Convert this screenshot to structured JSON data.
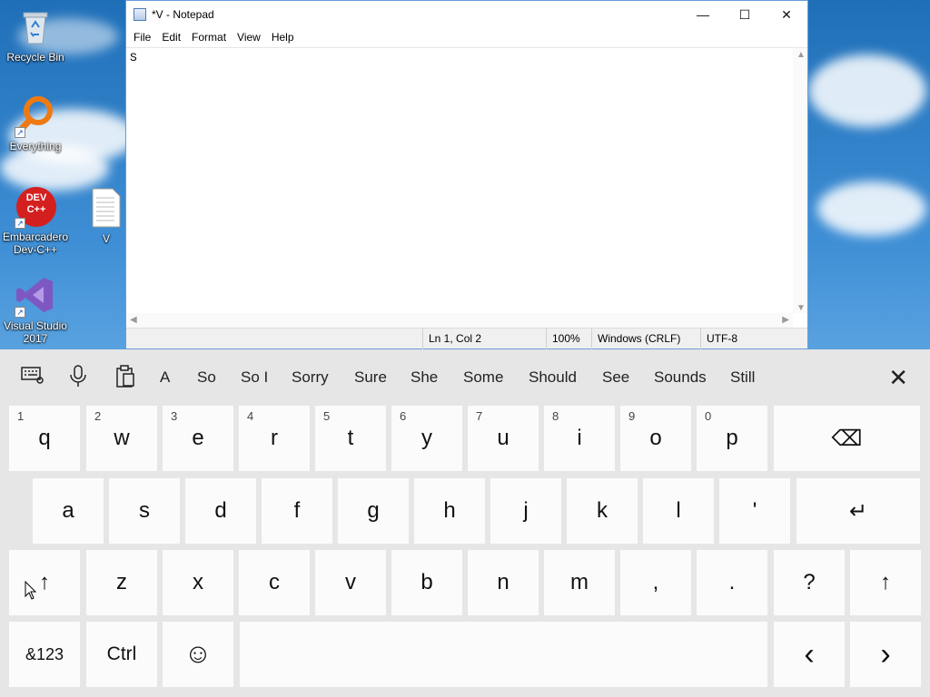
{
  "desktop": {
    "icons": [
      {
        "label": "Recycle Bin",
        "icon": "recycle-bin-icon"
      },
      {
        "label": "Everything",
        "icon": "everything-search-icon"
      },
      {
        "label": "Embarcadero Dev-C++",
        "icon": "devcpp-icon",
        "badge": "DEV C++"
      },
      {
        "label": "V",
        "icon": "text-file-icon"
      },
      {
        "label": "Visual Studio 2017",
        "icon": "visual-studio-icon"
      }
    ]
  },
  "notepad": {
    "title": "*V - Notepad",
    "menu": [
      "File",
      "Edit",
      "Format",
      "View",
      "Help"
    ],
    "content": "S",
    "status": {
      "position": "Ln 1, Col 2",
      "zoom": "100%",
      "line_endings": "Windows (CRLF)",
      "encoding": "UTF-8"
    }
  },
  "keyboard": {
    "suggestions": [
      "A",
      "So",
      "So I",
      "Sorry",
      "Sure",
      "She",
      "Some",
      "Should",
      "See",
      "Sounds",
      "Still"
    ],
    "row1": [
      {
        "k": "q",
        "n": "1"
      },
      {
        "k": "w",
        "n": "2"
      },
      {
        "k": "e",
        "n": "3"
      },
      {
        "k": "r",
        "n": "4"
      },
      {
        "k": "t",
        "n": "5"
      },
      {
        "k": "y",
        "n": "6"
      },
      {
        "k": "u",
        "n": "7"
      },
      {
        "k": "i",
        "n": "8"
      },
      {
        "k": "o",
        "n": "9"
      },
      {
        "k": "p",
        "n": "0"
      }
    ],
    "row2": [
      "a",
      "s",
      "d",
      "f",
      "g",
      "h",
      "j",
      "k",
      "l",
      "'"
    ],
    "row3": [
      "z",
      "x",
      "c",
      "v",
      "b",
      "n",
      "m",
      ",",
      ".",
      "?"
    ],
    "symbols_label": "&123",
    "ctrl_label": "Ctrl",
    "glyphs": {
      "backspace": "⌫",
      "enter": "↵",
      "shift": "↑",
      "emoji": "☺",
      "left": "‹",
      "right": "›",
      "close": "✕",
      "minimize": "—",
      "maximize": "☐",
      "win_close": "✕"
    }
  }
}
